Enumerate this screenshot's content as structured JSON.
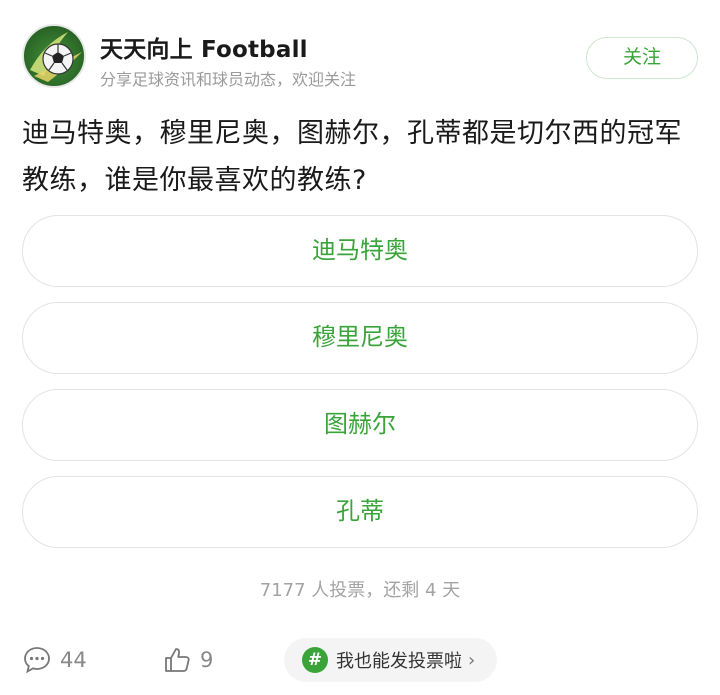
{
  "post": {
    "author": "天天向上 Football",
    "subtitle": "分享足球资讯和球员动态，欢迎关注",
    "follow_label": "关注"
  },
  "poll": {
    "question": "迪马特奥，穆里尼奥，图赫尔，孔蒂都是切尔西的冠军教练，谁是你最喜欢的教练?",
    "options": [
      "迪马特奥",
      "穆里尼奥",
      "图赫尔",
      "孔蒂"
    ],
    "stats": "7177 人投票，还剩 4 天"
  },
  "footer": {
    "comment_count": "44",
    "like_count": "9",
    "vote_cta": "我也能发投票啦",
    "hash_symbol": "#",
    "chevron": "›"
  },
  "colors": {
    "accent": "#3aa43a",
    "border": "#e3e3e3",
    "muted": "#9a9a9a"
  },
  "icons": {
    "avatar": "soccer-ball-logo",
    "comment": "comment-bubble-icon",
    "like": "thumbs-up-icon",
    "hash": "hashtag-icon",
    "chevron": "chevron-right-icon"
  }
}
